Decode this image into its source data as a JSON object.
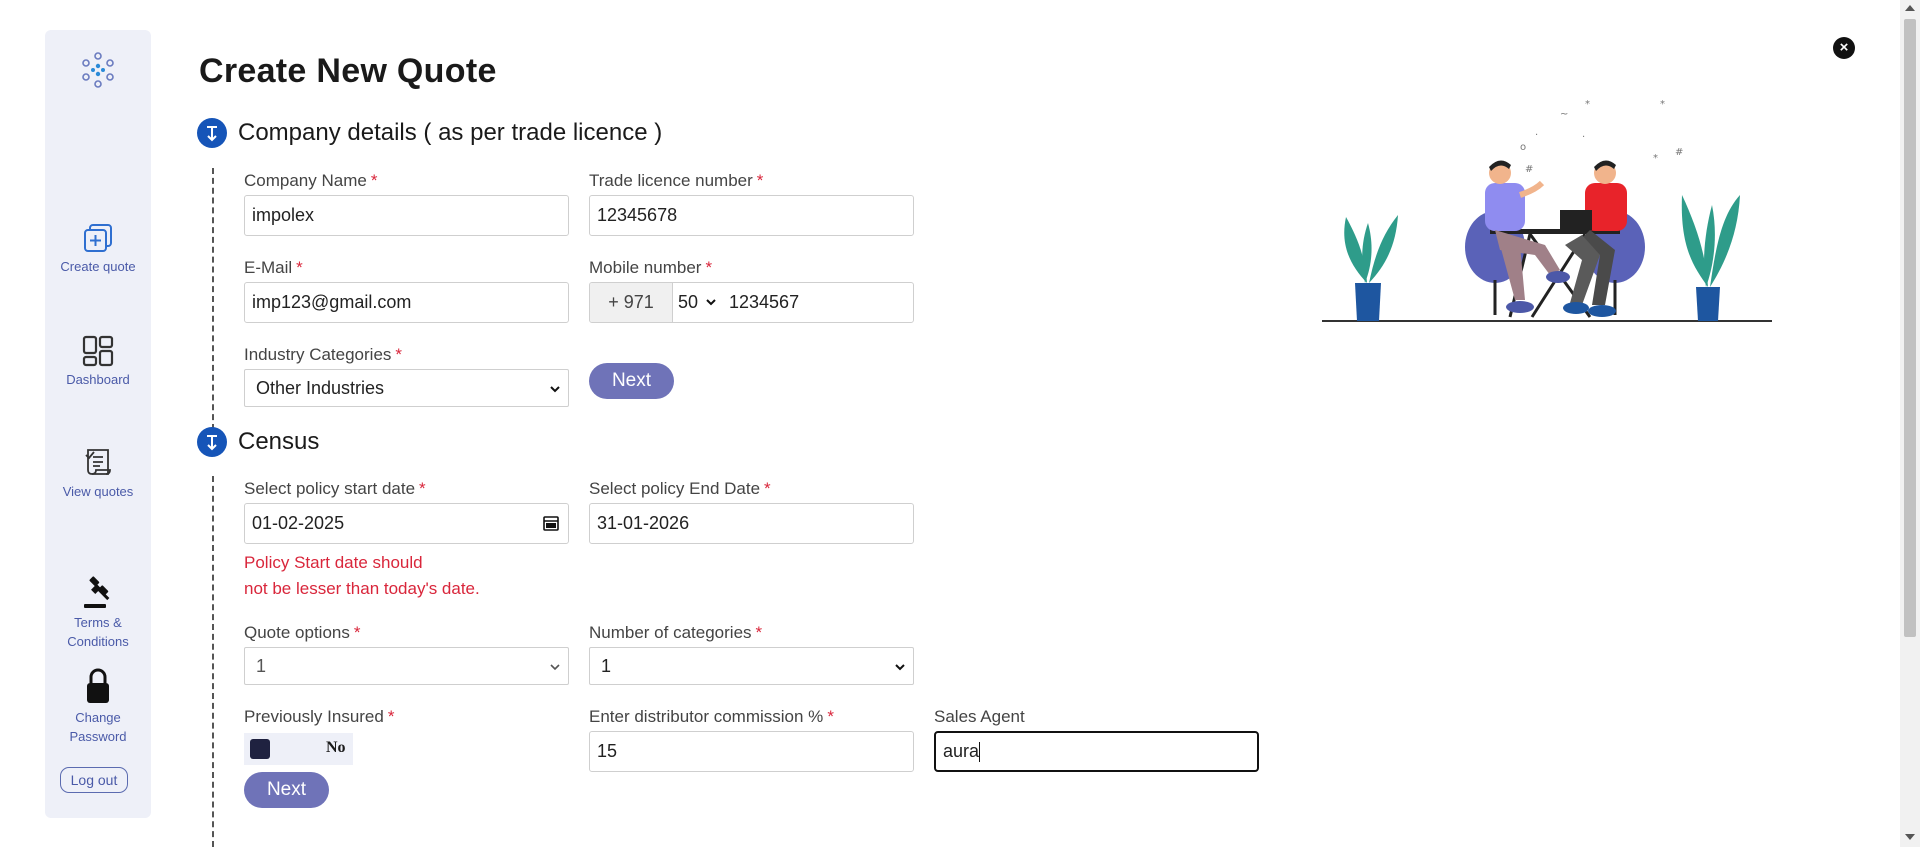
{
  "sidebar": {
    "items": [
      {
        "label": "Create quote"
      },
      {
        "label": "Dashboard"
      },
      {
        "label": "View quotes"
      },
      {
        "label": "Terms & Conditions"
      },
      {
        "label": "Change Password"
      }
    ],
    "logout_label": "Log out"
  },
  "page": {
    "title": "Create New Quote",
    "close_symbol": "×"
  },
  "company_section": {
    "title": "Company details ( as per trade licence )",
    "company_name": {
      "label": "Company Name",
      "value": "impolex"
    },
    "trade_licence": {
      "label": "Trade licence number",
      "value": "12345678"
    },
    "email": {
      "label": "E-Mail",
      "value": "imp123@gmail.com"
    },
    "mobile": {
      "label": "Mobile number",
      "country_code": "+ 971",
      "prefix": "50",
      "value": "1234567"
    },
    "industry": {
      "label": "Industry Categories",
      "value": "Other Industries"
    },
    "next_label": "Next",
    "required_mark": "*"
  },
  "census_section": {
    "title": "Census",
    "start_date": {
      "label": "Select policy start date",
      "value": "01-02-2025"
    },
    "end_date": {
      "label": "Select policy End Date",
      "value": "31-01-2026"
    },
    "error_line1": "Policy Start date should",
    "error_line2": "not be lesser than today's date.",
    "quote_options": {
      "label": "Quote options",
      "value": "1"
    },
    "num_categories": {
      "label": "Number of categories",
      "value": "1"
    },
    "previously_insured": {
      "label": "Previously Insured",
      "value": "No"
    },
    "commission": {
      "label": "Enter distributor commission %",
      "value": "15"
    },
    "sales_agent": {
      "label": "Sales Agent",
      "value": "aura"
    },
    "next_label": "Next",
    "required_mark": "*"
  },
  "colors": {
    "accent": "#1655b8",
    "button": "#6f73b8",
    "error": "#d9263b",
    "sidebar_bg": "#eef0f8"
  }
}
